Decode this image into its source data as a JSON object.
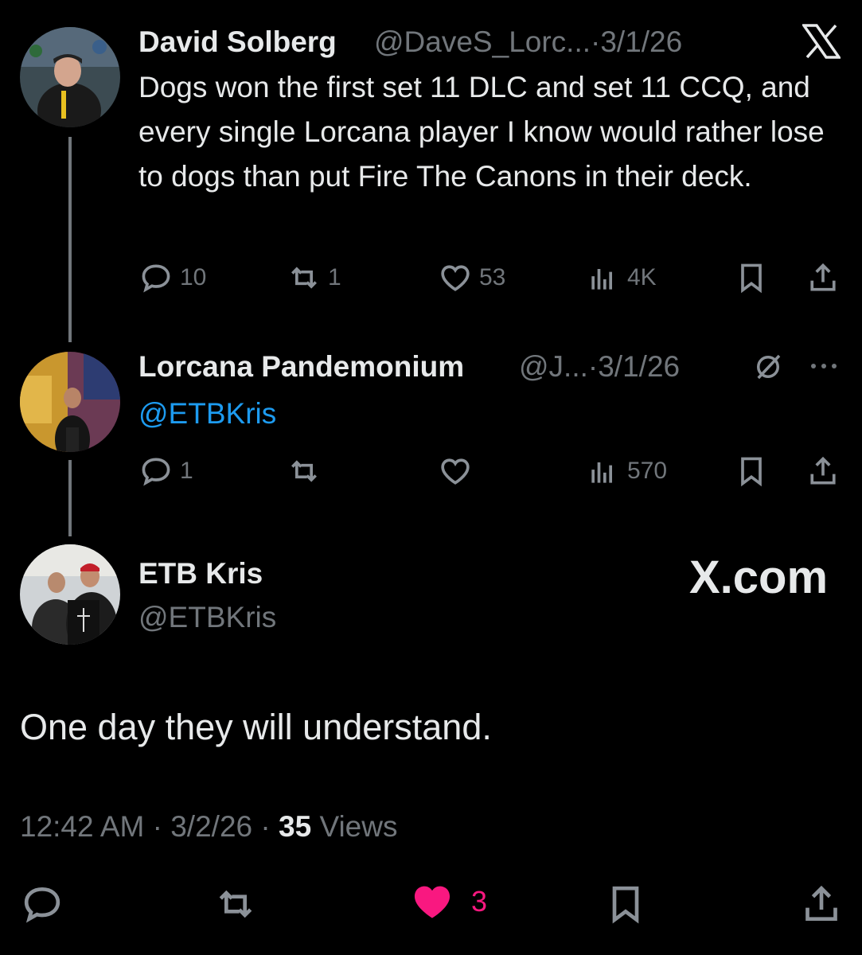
{
  "tweet1": {
    "name": "David Solberg",
    "handle": "@DaveS_Lorc...",
    "sep": "·",
    "date": "3/1/26",
    "text": "Dogs won the first set 11 DLC and set 11 CCQ, and every single Lorcana player I know would rather lose to dogs than put Fire The Canons in their deck.",
    "replies": "10",
    "reposts": "1",
    "likes": "53",
    "views": "4K",
    "corner_icon": "x-logo-icon"
  },
  "tweet2": {
    "name": "Lorcana Pandemonium",
    "handle": "@J...",
    "sep": "·",
    "date": "3/1/26",
    "text": "@ETBKris",
    "replies": "1",
    "reposts": "",
    "likes": "",
    "views": "570",
    "corner_icons": [
      "grok-icon",
      "more-icon"
    ]
  },
  "main_tweet": {
    "name": "ETB Kris",
    "handle": "@ETBKris",
    "brand": "X.com",
    "text": "One day they will understand.",
    "time": "12:42 AM",
    "sep": "·",
    "date": "3/2/26",
    "views_count": "35",
    "views_label": "Views",
    "likes": "3",
    "like_color": "#f91880"
  },
  "colors": {
    "background": "#000000",
    "text": "#e7e9ea",
    "muted": "#71767b",
    "link": "#1d9bf0"
  }
}
